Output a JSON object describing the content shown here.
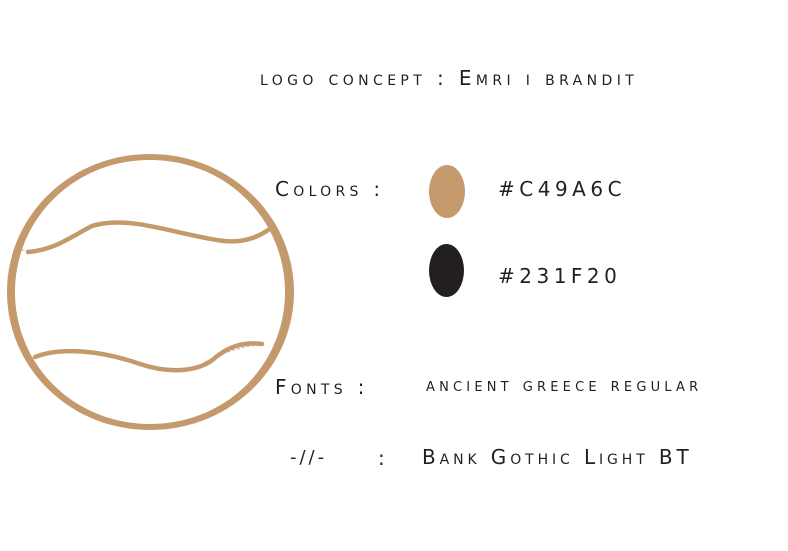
{
  "title": "logo concept : Emri i brandit",
  "colors": {
    "label": "Colors :",
    "items": [
      {
        "hex": "#C49A6C",
        "label": "#C49A6C"
      },
      {
        "hex": "#231F20",
        "label": "#231F20"
      }
    ]
  },
  "fonts": {
    "label": "Fonts :",
    "primary": "ancient greece regular",
    "ditto": "-//-",
    "separator": ":",
    "secondary": "Bank Gothic Light BT"
  },
  "logo": {
    "icon": "baseball-seam-circle-icon",
    "color": "#C49A6C"
  }
}
